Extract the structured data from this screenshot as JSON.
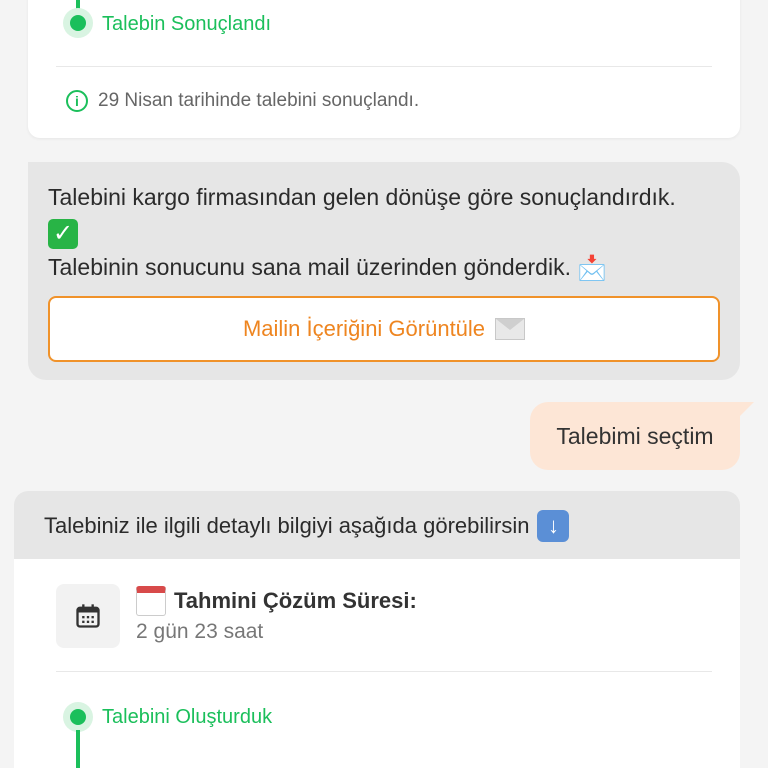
{
  "top_card": {
    "step_label": "Talebin Sonuçlandı",
    "info_text": "29 Nisan tarihinde talebini sonuçlandı."
  },
  "bot_message": {
    "line1": "Talebini kargo firmasından gelen dönüşe göre sonuçlandırdık.",
    "line2": "Talebinin sonucunu sana mail üzerinden gönderdik.",
    "button_label": "Mailin İçeriğini Görüntüle"
  },
  "user_message": {
    "text": "Talebimi seçtim"
  },
  "detail_card": {
    "header_text": "Talebiniz ile ilgili detaylı bilgiyi aşağıda görebilirsin",
    "eta_title": "Tahmini Çözüm Süresi:",
    "eta_value": "2 gün 23 saat",
    "step_label": "Talebini Oluşturduk"
  },
  "colors": {
    "accent_green": "#1bbf5b",
    "accent_orange": "#ee8520",
    "user_bubble": "#fde6d6",
    "bot_bubble": "#e6e6e6"
  }
}
